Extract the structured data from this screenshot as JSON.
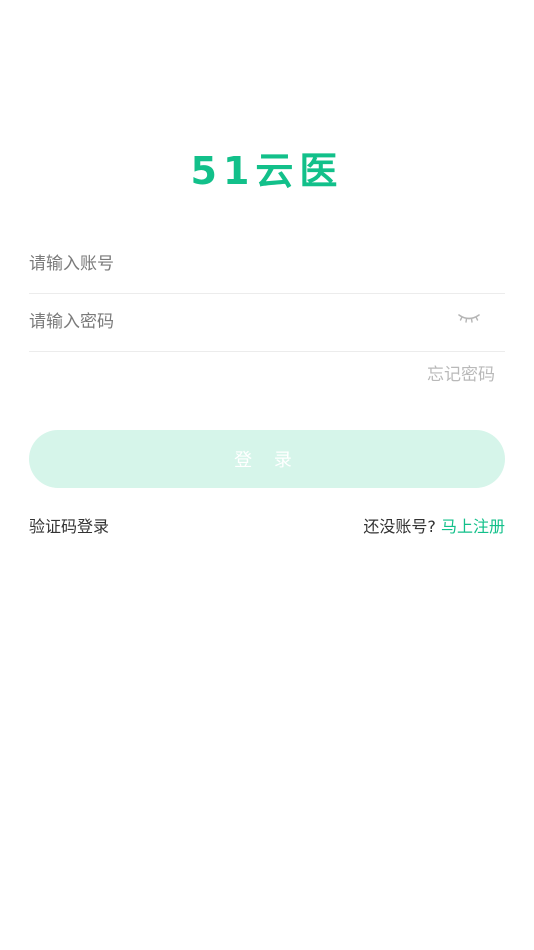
{
  "app": {
    "logo_text": "51云医",
    "brand_color": "#12c08a"
  },
  "form": {
    "account_placeholder": "请输入账号",
    "password_placeholder": "请输入密码",
    "eye_icon": "eye-closed-icon",
    "forgot_password": "忘记密码",
    "login_button": "登 录",
    "login_button_color": "#d6f5ea"
  },
  "footer": {
    "sms_login": "验证码登录",
    "no_account_text": "还没账号?",
    "register_link": "马上注册"
  }
}
